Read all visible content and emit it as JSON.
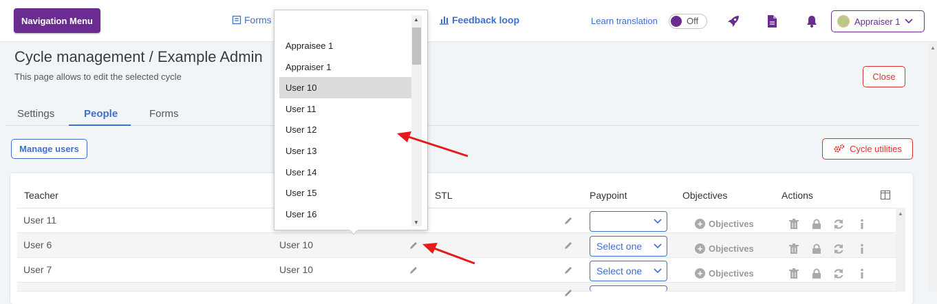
{
  "header": {
    "nav_menu": "Navigation Menu",
    "forms": "Forms",
    "feedback": "Feedback loop",
    "learn_translation": "Learn translation",
    "toggle_state": "Off",
    "user": "Appraiser 1",
    "brand_color": "#6a2c91",
    "link_color": "#3d6fd1"
  },
  "page": {
    "title": "Cycle management / Example Admin",
    "subtitle": "This page allows to edit the selected cycle",
    "close": "Close"
  },
  "tabs": [
    "Settings",
    "People",
    "Forms"
  ],
  "toolbar": {
    "manage_users": "Manage users",
    "cycle_utilities": "Cycle utilities"
  },
  "table": {
    "headers": {
      "teacher": "Teacher",
      "stl": "STL",
      "paypoint": "Paypoint",
      "objectives": "Objectives",
      "actions": "Actions"
    },
    "rows": [
      {
        "teacher": "User 11",
        "reviewer": "",
        "paypoint": "",
        "objectives": "Objectives"
      },
      {
        "teacher": "User 6",
        "reviewer": "User 10",
        "paypoint": "Select one",
        "objectives": "Objectives"
      },
      {
        "teacher": "User 7",
        "reviewer": "User 10",
        "paypoint": "Select one",
        "objectives": "Objectives"
      }
    ]
  },
  "dropdown": {
    "options": [
      "Appraisee 1",
      "Appraiser 1",
      "User 10",
      "User 11",
      "User 12",
      "User 13",
      "User 14",
      "User 15",
      "User 16"
    ],
    "highlighted": "User 10"
  },
  "annotation_color": "#e31b1b"
}
